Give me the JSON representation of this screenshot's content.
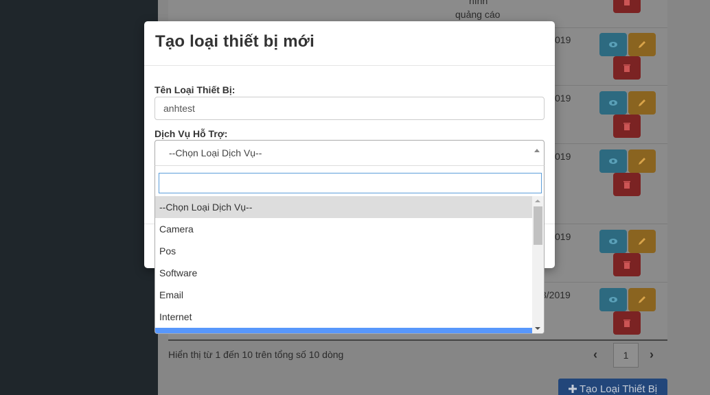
{
  "background": {
    "rows": [
      {
        "text_a": "hình",
        "text_b": "quảng cáo",
        "date": ""
      },
      {
        "date": "019"
      },
      {
        "date": "019"
      },
      {
        "date": "019"
      },
      {
        "date": "019"
      },
      {
        "date": "3/2019"
      }
    ],
    "paging_info": "Hiển thị từ 1 đến 10 trên tổng số 10 dòng",
    "page_prev": "‹",
    "page_current": "1",
    "page_next": "›",
    "create_button": "Tạo Loại Thiết Bị"
  },
  "modal": {
    "title": "Tạo loại thiết bị mới",
    "name_label": "Tên Loại Thiết Bị:",
    "name_value": "anhtest",
    "service_label": "Dịch Vụ Hỗ Trợ:",
    "service_selected": "--Chọn Loại Dịch Vụ--",
    "search_value": "",
    "options": [
      "--Chọn Loại Dịch Vụ--",
      "Camera",
      "Pos",
      "Software",
      "Email",
      "Internet",
      ""
    ]
  }
}
